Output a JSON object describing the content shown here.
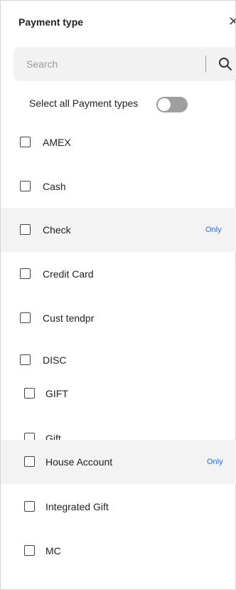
{
  "header": {
    "title": "Payment type",
    "close_icon": "close-icon"
  },
  "search": {
    "placeholder": "Search",
    "icon": "search-icon"
  },
  "select_all": {
    "label": "Select all Payment types",
    "toggle_on": false
  },
  "colors": {
    "accent": "#2f6ed8",
    "row_highlight": "#f3f3f3",
    "search_bg": "#f2f2f2",
    "toggle_off": "#9e9e9e"
  },
  "payment_types": [
    {
      "label": "AMEX",
      "checked": false,
      "only_label": ""
    },
    {
      "label": "Cash",
      "checked": false,
      "only_label": ""
    },
    {
      "label": "Check",
      "checked": false,
      "only_label": "Only"
    },
    {
      "label": "Credit Card",
      "checked": false,
      "only_label": ""
    },
    {
      "label": "Cust tendpr",
      "checked": false,
      "only_label": ""
    },
    {
      "label": "DISC",
      "checked": false,
      "only_label": ""
    },
    {
      "label": "GIFT",
      "checked": false,
      "only_label": ""
    },
    {
      "label": "Gift",
      "checked": false,
      "only_label": ""
    },
    {
      "label": "House Account",
      "checked": false,
      "only_label": "Only"
    },
    {
      "label": "Integrated Gift",
      "checked": false,
      "only_label": ""
    },
    {
      "label": "MC",
      "checked": false,
      "only_label": ""
    }
  ]
}
